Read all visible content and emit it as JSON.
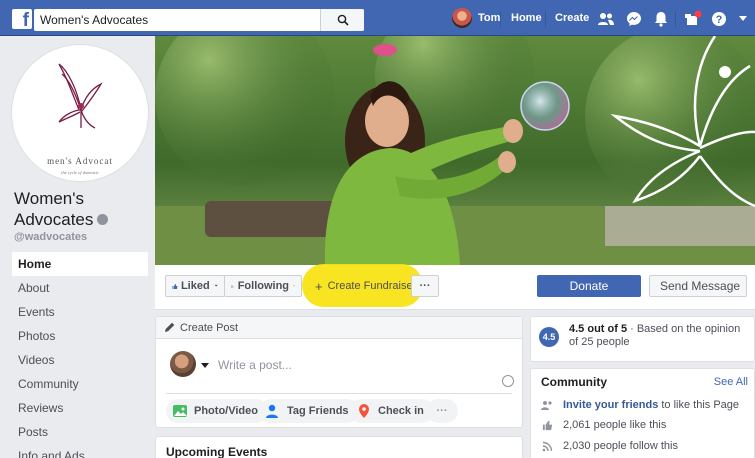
{
  "topbar": {
    "search_value": "Women's Advocates",
    "user_name": "Tom",
    "home_label": "Home",
    "create_label": "Create"
  },
  "page": {
    "name": "Women's Advocates",
    "handle": "@wadvocates",
    "logo_text": "Women's Advocates",
    "logo_tagline": "the cycle of domestic"
  },
  "sidebar": {
    "items": [
      {
        "label": "Home"
      },
      {
        "label": "About"
      },
      {
        "label": "Events"
      },
      {
        "label": "Photos"
      },
      {
        "label": "Videos"
      },
      {
        "label": "Community"
      },
      {
        "label": "Reviews"
      },
      {
        "label": "Posts"
      },
      {
        "label": "Info and Ads"
      }
    ]
  },
  "actions": {
    "liked": "Liked",
    "following": "Following",
    "fundraiser": "Create Fundraiser",
    "more": "···",
    "donate": "Donate",
    "send_message": "Send Message"
  },
  "create_post": {
    "title": "Create Post",
    "placeholder": "Write a post...",
    "buttons": [
      {
        "label": "Photo/Video"
      },
      {
        "label": "Tag Friends"
      },
      {
        "label": "Check in"
      }
    ],
    "more": "···"
  },
  "events": {
    "title": "Upcoming Events"
  },
  "rating": {
    "badge": "4.5",
    "score_text": "4.5 out of 5",
    "detail": " · Based on the opinion of 25 people"
  },
  "community": {
    "title": "Community",
    "see_all": "See All",
    "invite_link": "Invite your friends",
    "invite_rest": "to like this Page",
    "likes": "2,061 people like this",
    "follows": "2,030 people follow this"
  },
  "colors": {
    "brand": "#4267b2",
    "highlight": "#f9e20f",
    "background": "#e9ebee"
  }
}
